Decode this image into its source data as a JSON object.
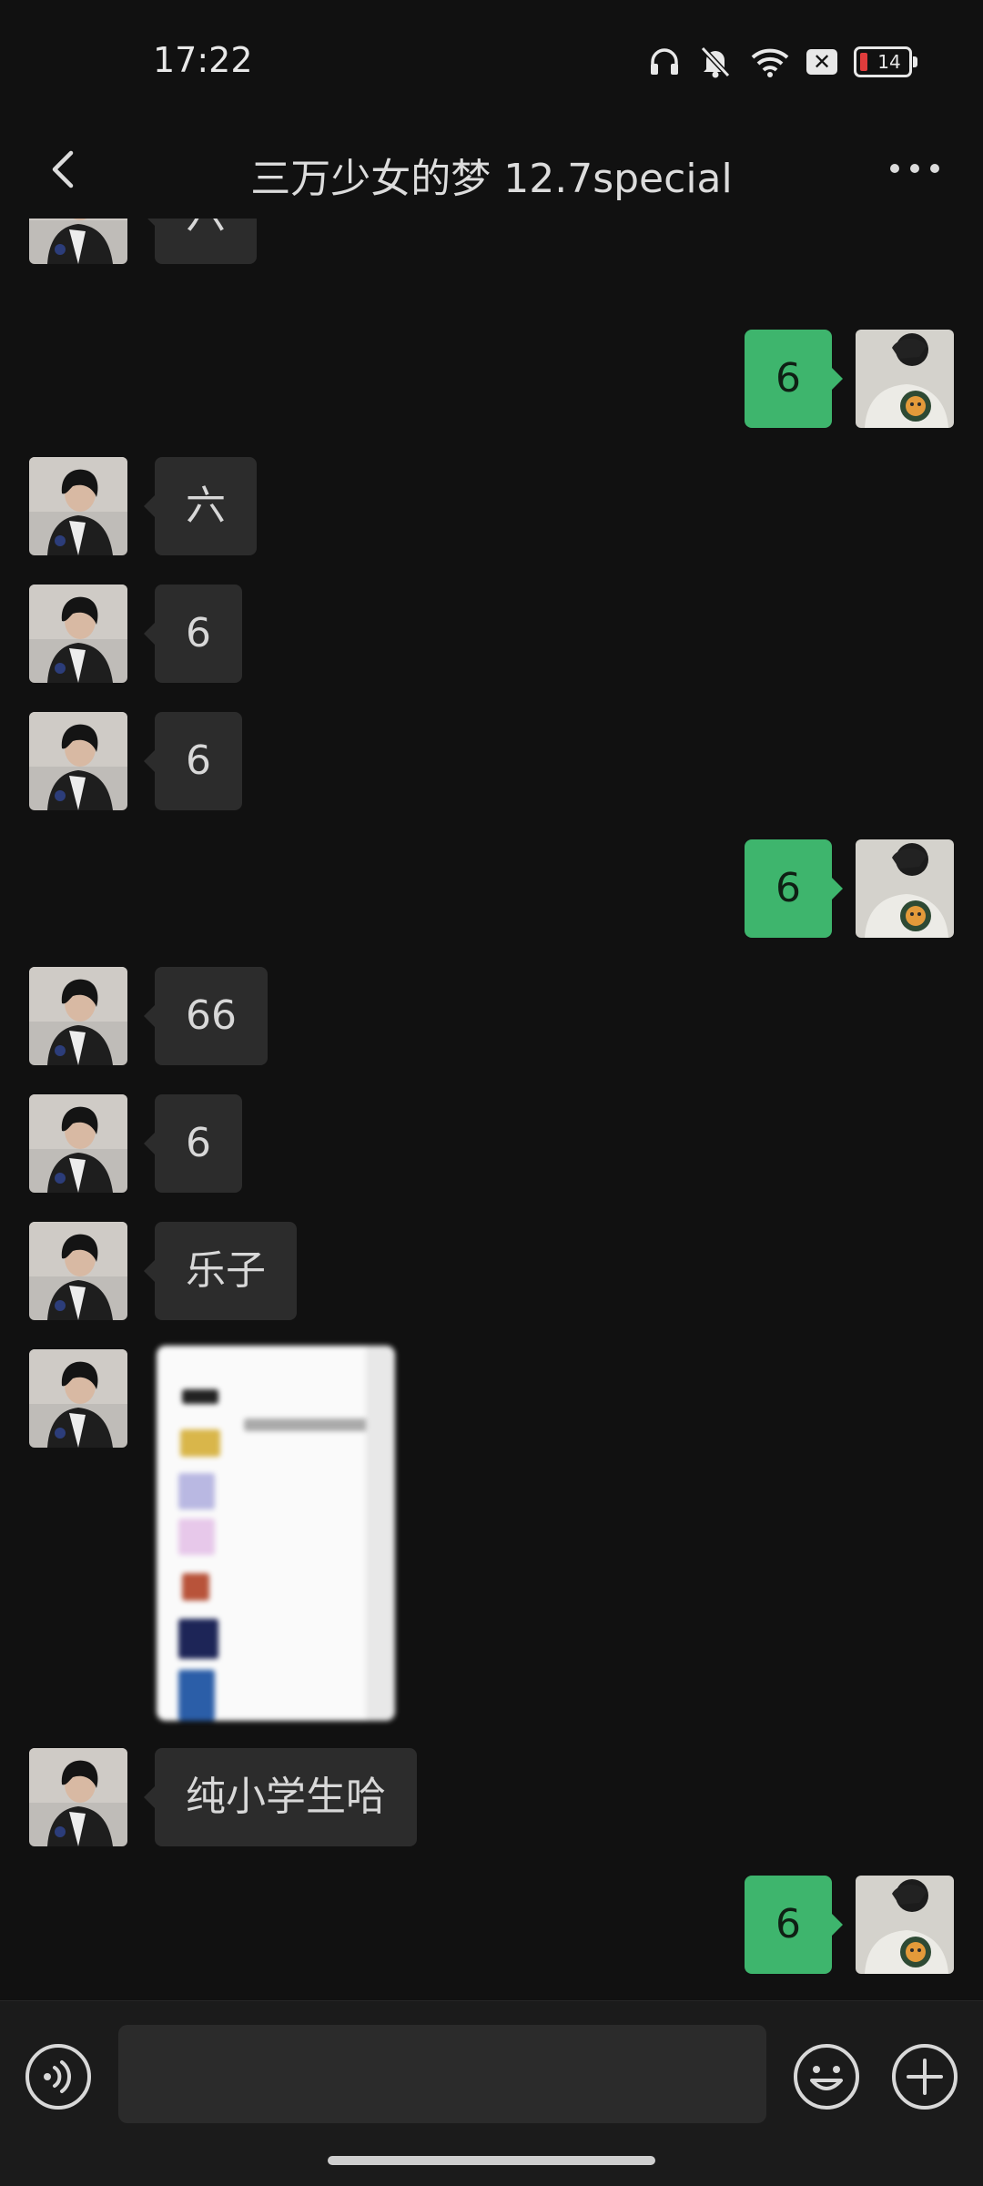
{
  "status_bar": {
    "time": "17:22",
    "battery": "14"
  },
  "header": {
    "title": "三万少女的梦 12.7special"
  },
  "messages": [
    {
      "side": "in",
      "text": "六"
    },
    {
      "side": "out",
      "text": "6"
    },
    {
      "side": "in",
      "text": "六"
    },
    {
      "side": "in",
      "text": "6"
    },
    {
      "side": "in",
      "text": "6"
    },
    {
      "side": "out",
      "text": "6"
    },
    {
      "side": "in",
      "text": "66"
    },
    {
      "side": "in",
      "text": "6"
    },
    {
      "side": "in",
      "text": "乐子"
    },
    {
      "side": "in",
      "type": "image"
    },
    {
      "side": "in",
      "text": "纯小学生哈"
    },
    {
      "side": "out",
      "text": "6"
    }
  ],
  "input": {
    "placeholder": ""
  },
  "colors": {
    "background": "#111111",
    "bubble_in": "#2c2c2c",
    "bubble_out": "#3eb56d",
    "input_bar": "#1b1b1b"
  }
}
